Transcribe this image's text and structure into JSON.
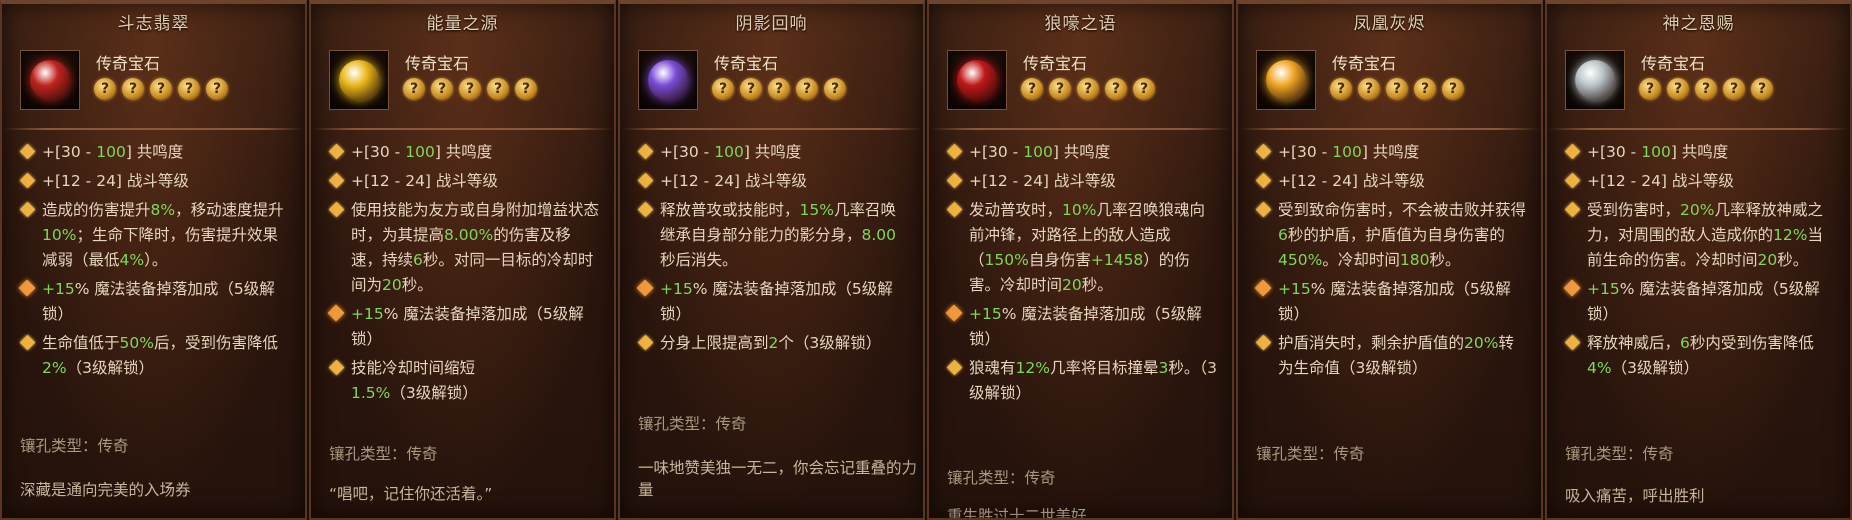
{
  "rarity": "传奇宝石",
  "star_glyph": "?",
  "socket_label": "镶孔类型：传奇",
  "cards": [
    {
      "title": "斗志翡翠",
      "gem_color": "#c0241e",
      "affixes": [
        {
          "type": "base",
          "text": "+[30 - 100] 共鸣度"
        },
        {
          "type": "base",
          "text": "+[12 - 24] 战斗等级"
        },
        {
          "type": "base",
          "text": "造成的伤害提升8%，移动速度提升10%；生命下降时，伤害提升效果减弱（最低4%）。"
        },
        {
          "type": "locked",
          "text": "+15% 魔法装备掉落加成（5级解锁）"
        },
        {
          "type": "base",
          "text": "生命值低于50%后，受到伤害降低2%（3级解锁）"
        }
      ],
      "flavor": "深藏是通向完美的入场券"
    },
    {
      "title": "能量之源",
      "gem_color": "#e8b81a",
      "affixes": [
        {
          "type": "base",
          "text": "+[30 - 100] 共鸣度"
        },
        {
          "type": "base",
          "text": "+[12 - 24] 战斗等级"
        },
        {
          "type": "base",
          "text": "使用技能为友方或自身附加增益状态时，为其提高8.00%的伤害及移速，持续6秒。对同一目标的冷却时间为20秒。"
        },
        {
          "type": "locked",
          "text": "+15% 魔法装备掉落加成（5级解锁）"
        },
        {
          "type": "base",
          "text": "技能冷却时间缩短1.5%（3级解锁）"
        }
      ],
      "flavor": "“唱吧，记住你还活着。”"
    },
    {
      "title": "阴影回响",
      "gem_color": "#7a4bd6",
      "affixes": [
        {
          "type": "base",
          "text": "+[30 - 100] 共鸣度"
        },
        {
          "type": "base",
          "text": "+[12 - 24] 战斗等级"
        },
        {
          "type": "base",
          "text": "释放普攻或技能时，15%几率召唤继承自身部分能力的影分身，8.00秒后消失。"
        },
        {
          "type": "locked",
          "text": "+15% 魔法装备掉落加成（5级解锁）"
        },
        {
          "type": "base",
          "text": "分身上限提高到2个（3级解锁）"
        }
      ],
      "flavor": "一味地赞美独一无二，你会忘记重叠的力量"
    },
    {
      "title": "狼嚎之语",
      "gem_color": "#c01818",
      "affixes": [
        {
          "type": "base",
          "text": "+[30 - 100] 共鸣度"
        },
        {
          "type": "base",
          "text": "+[12 - 24] 战斗等级"
        },
        {
          "type": "base",
          "text": "发动普攻时，10%几率召唤狼魂向前冲锋，对路径上的敌人造成（150%自身伤害+1458）的伤害。冷却时间20秒。"
        },
        {
          "type": "locked",
          "text": "+15% 魔法装备掉落加成（5级解锁）"
        },
        {
          "type": "base",
          "text": "狼魂有12%几率将目标撞晕3秒。（3级解锁）"
        }
      ],
      "flavor": "重生胜过十二世美好"
    },
    {
      "title": "凤凰灰烬",
      "gem_color": "#f0a624",
      "affixes": [
        {
          "type": "base",
          "text": "+[30 - 100] 共鸣度"
        },
        {
          "type": "base",
          "text": "+[12 - 24] 战斗等级"
        },
        {
          "type": "base",
          "text": "受到致命伤害时，不会被击败并获得6秒的护盾，护盾值为自身伤害的450%。冷却时间180秒。"
        },
        {
          "type": "locked",
          "text": "+15% 魔法装备掉落加成（5级解锁）"
        },
        {
          "type": "base",
          "text": "护盾消失时，剩余护盾值的20%转为生命值（3级解锁）"
        }
      ],
      "flavor": ""
    },
    {
      "title": "神之恩赐",
      "gem_color": "#b9c4c8",
      "affixes": [
        {
          "type": "base",
          "text": "+[30 - 100] 共鸣度"
        },
        {
          "type": "base",
          "text": "+[12 - 24] 战斗等级"
        },
        {
          "type": "base",
          "text": "受到伤害时，20%几率释放神威之力，对周围的敌人造成你的12%当前生命的伤害。冷却时间20秒。"
        },
        {
          "type": "locked",
          "text": "+15% 魔法装备掉落加成（5级解锁）"
        },
        {
          "type": "base",
          "text": "释放神威后，6秒内受到伤害降低4%（3级解锁）"
        }
      ],
      "flavor": "吸入痛苦，呼出胜利"
    }
  ],
  "layout_css": "row-of-six"
}
